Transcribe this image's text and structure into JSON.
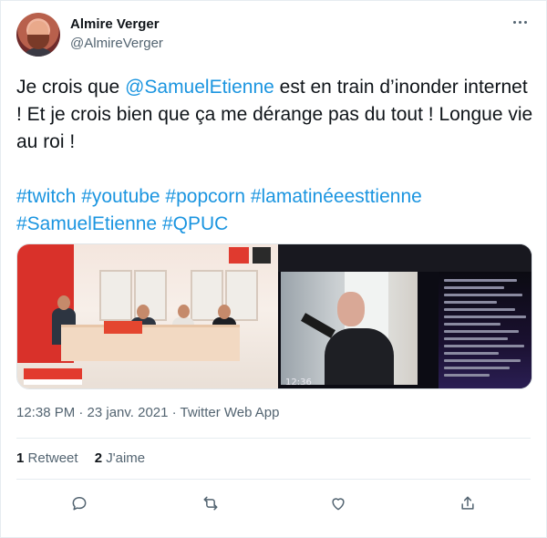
{
  "tweet": {
    "author": {
      "name": "Almire Verger",
      "handle": "@AlmireVerger"
    },
    "text": {
      "line1_before": "Je crois que ",
      "mention": "@SamuelEtienne",
      "line1_after": " est en train d’inonder internet ! Et je crois bien que ça me dérange pas du tout ! Longue vie au roi !",
      "hashtags_line1": "#twitch #youtube #popcorn #lamatinéeesttienne",
      "hashtags_line2": "#SamuelEtienne #QPUC"
    },
    "media": {
      "timestamp_overlay": "12:36"
    },
    "meta": "12:38 PM · 23 janv. 2021 · Twitter Web App",
    "stats": {
      "retweets_count": "1",
      "retweets_label": "Retweet",
      "likes_count": "2",
      "likes_label": "J'aime"
    },
    "actions": [
      "reply-icon",
      "retweet-icon",
      "like-icon",
      "share-icon"
    ]
  },
  "colors": {
    "link": "#1b95e0",
    "secondary_text": "#536471",
    "primary_text": "#0f1419"
  }
}
